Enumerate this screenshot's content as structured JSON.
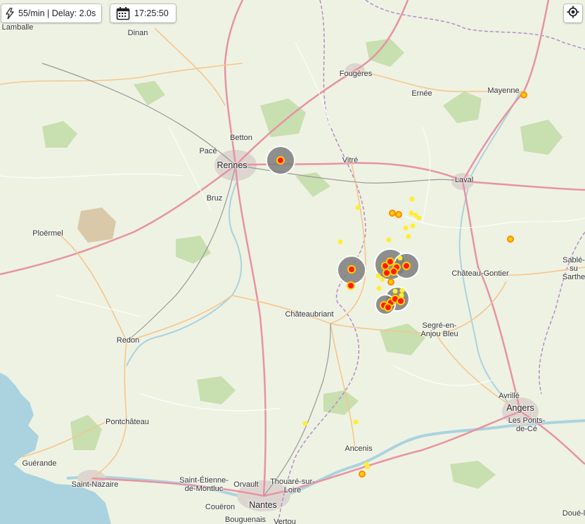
{
  "toolbar": {
    "rate_text": "55/min | Delay: 2.0s",
    "time_text": "17:25:50"
  },
  "icons": {
    "rate": "lightning-icon",
    "time": "calendar-icon",
    "locate": "crosshair-icon"
  },
  "colors": {
    "land": "#eef2e3",
    "water": "#aad3df",
    "strike_recent": "#ff1a00",
    "strike_ring": "#ffd000",
    "strike_old": "#ffee33",
    "strike_older": "#ff8800",
    "cluster": "#7d7d7d"
  },
  "places": [
    {
      "id": "lamballe",
      "name": "Lamballe"
    },
    {
      "id": "dinan",
      "name": "Dinan"
    },
    {
      "id": "fougeres",
      "name": "Fougères"
    },
    {
      "id": "ernee",
      "name": "Ernée"
    },
    {
      "id": "mayenne",
      "name": "Mayenne"
    },
    {
      "id": "betton",
      "name": "Betton"
    },
    {
      "id": "pace",
      "name": "Pacé"
    },
    {
      "id": "rennes",
      "name": "Rennes"
    },
    {
      "id": "vitre",
      "name": "Vitré"
    },
    {
      "id": "laval",
      "name": "Laval"
    },
    {
      "id": "bruz",
      "name": "Bruz"
    },
    {
      "id": "ploermel",
      "name": "Ploërmel"
    },
    {
      "id": "sable",
      "name": "Sablé-su\nSarthe"
    },
    {
      "id": "chateau_gontier",
      "name": "Château-Gontier"
    },
    {
      "id": "chateaubriant",
      "name": "Châteaubriant"
    },
    {
      "id": "segre",
      "name": "Segré-en-\nAnjou Bleu"
    },
    {
      "id": "redon",
      "name": "Redon"
    },
    {
      "id": "avrille",
      "name": "Avrillé"
    },
    {
      "id": "angers",
      "name": "Angers"
    },
    {
      "id": "ponts_de_ce",
      "name": "Les Ponts-\nde-Cé"
    },
    {
      "id": "pontchateau",
      "name": "Pontchâteau"
    },
    {
      "id": "ancenis",
      "name": "Ancenis"
    },
    {
      "id": "guerande",
      "name": "Guérande"
    },
    {
      "id": "saint_nazaire",
      "name": "Saint-Nazaire"
    },
    {
      "id": "saint_etienne",
      "name": "Saint-Étienne-\nde-Montluc"
    },
    {
      "id": "orvault",
      "name": "Orvault"
    },
    {
      "id": "thouare",
      "name": "Thouaré-sur-\nLoire"
    },
    {
      "id": "nantes",
      "name": "Nantes"
    },
    {
      "id": "coueron",
      "name": "Couëron"
    },
    {
      "id": "bouguenais",
      "name": "Bouguenais"
    },
    {
      "id": "vertou",
      "name": "Vertou"
    },
    {
      "id": "doue",
      "name": "Doué-l"
    }
  ]
}
